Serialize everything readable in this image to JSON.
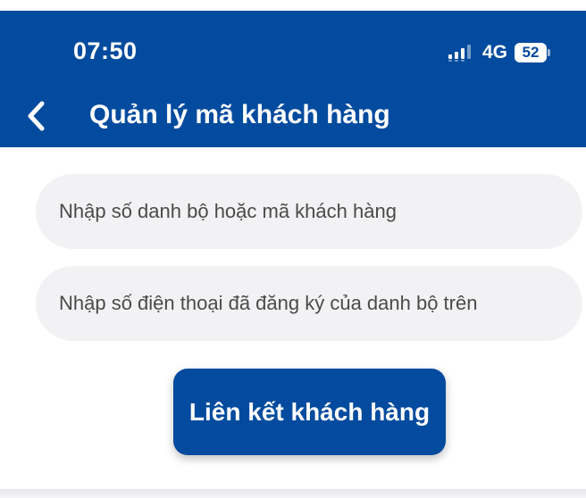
{
  "status_bar": {
    "time": "07:50",
    "network": "4G",
    "battery": "52",
    "signal_icon": "cellular-signal-icon",
    "battery_icon": "battery-icon"
  },
  "header": {
    "title": "Quản lý mã khách hàng",
    "back_icon": "chevron-left-icon",
    "background_color": "#034b9e"
  },
  "form": {
    "customer_code_placeholder": "Nhập số danh bộ hoặc mã khách hàng",
    "customer_code_value": "",
    "phone_placeholder": "Nhập số điện thoại đã đăng ký của danh bộ trên",
    "phone_value": "",
    "submit_label": "Liên kết khách hàng"
  },
  "colors": {
    "primary": "#034b9e",
    "field_background": "#f2f2f4",
    "text_on_primary": "#ffffff"
  }
}
